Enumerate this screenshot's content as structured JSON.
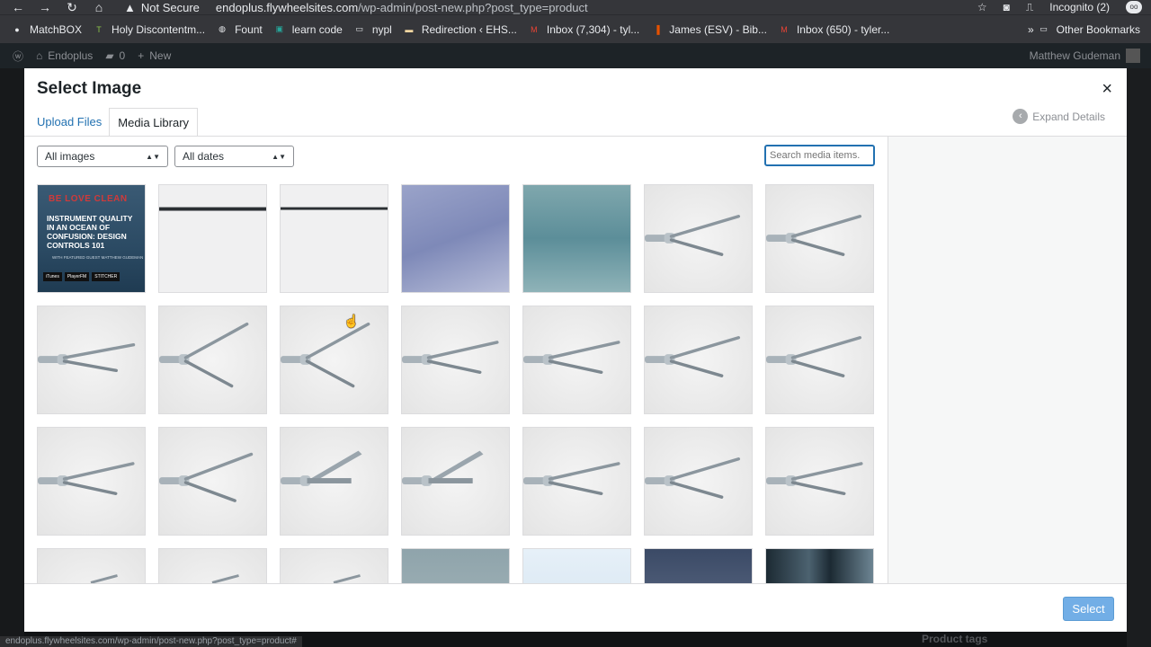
{
  "browser": {
    "security": "Not Secure",
    "url_host": "endoplus.flywheelsites.com",
    "url_path": "/wp-admin/post-new.php?post_type=product",
    "incognito": "Incognito (2)",
    "bookmarks": [
      {
        "label": "MatchBOX",
        "icon": "matchbox-icon",
        "color": "#e8eaed"
      },
      {
        "label": "Holy Discontentm...",
        "icon": "tgc-icon",
        "color": "#8bc34a"
      },
      {
        "label": "Fount",
        "icon": "globe-icon",
        "color": "#e8eaed"
      },
      {
        "label": "learn code",
        "icon": "code-icon",
        "color": "#26a69a"
      },
      {
        "label": "nypl",
        "icon": "folder-icon",
        "color": "#e8eaed"
      },
      {
        "label": "Redirection ‹ EHS...",
        "icon": "redirection-icon",
        "color": "#f5d7a1"
      },
      {
        "label": "Inbox (7,304) - tyl...",
        "icon": "gmail-icon",
        "color": "#ea4335"
      },
      {
        "label": "James (ESV) - Bib...",
        "icon": "bible-icon",
        "color": "#e65100"
      },
      {
        "label": "Inbox (650) - tyler...",
        "icon": "gmail-icon",
        "color": "#ea4335"
      }
    ],
    "more": "»",
    "other_bookmarks": "Other Bookmarks",
    "status_url": "endoplus.flywheelsites.com/wp-admin/post-new.php?post_type=product#"
  },
  "adminbar": {
    "site_name": "Endoplus",
    "comments": "0",
    "new_label": "New",
    "user": "Matthew Gudeman"
  },
  "modal": {
    "title": "Select Image",
    "close": "×",
    "tabs": [
      "Upload Files",
      "Media Library"
    ],
    "expand_details": "Expand Details",
    "filter_type": "All images",
    "filter_date": "All dates",
    "search_placeholder": "Search media items.",
    "select_button": "Select"
  },
  "background": {
    "product_tags": "Product tags"
  },
  "podcast_tile": {
    "logo": "BE LOVE CLEAN",
    "headline": "Instrument Quality in an Ocean of Confusion: Design Controls 101",
    "sub": "WITH FEATURED GUEST MATTHEW GUDEMAN",
    "badges": [
      "iTunes",
      "PlayerFM",
      "STITCHER"
    ]
  },
  "media_items": [
    {
      "kind": "podcast"
    },
    {
      "kind": "line"
    },
    {
      "kind": "line-thin"
    },
    {
      "kind": "photo-purple"
    },
    {
      "kind": "photo-surgery"
    },
    {
      "kind": "grasper",
      "angle": 18
    },
    {
      "kind": "grasper",
      "angle": 18
    },
    {
      "kind": "grasper",
      "angle": 12
    },
    {
      "kind": "grasper",
      "angle": 30
    },
    {
      "kind": "grasper",
      "angle": 30
    },
    {
      "kind": "grasper",
      "angle": 14
    },
    {
      "kind": "grasper",
      "angle": 14
    },
    {
      "kind": "grasper",
      "angle": 18
    },
    {
      "kind": "grasper",
      "angle": 18
    },
    {
      "kind": "grasper",
      "angle": 14
    },
    {
      "kind": "grasper",
      "angle": 22
    },
    {
      "kind": "scissor",
      "angle": 14
    },
    {
      "kind": "scissor",
      "angle": 14
    },
    {
      "kind": "grasper",
      "angle": 14
    },
    {
      "kind": "grasper",
      "angle": 18
    },
    {
      "kind": "grasper",
      "angle": 14
    },
    {
      "kind": "grasper-partial"
    },
    {
      "kind": "grasper-partial"
    },
    {
      "kind": "grasper-partial"
    },
    {
      "kind": "photo-desk"
    },
    {
      "kind": "photo-illustration"
    },
    {
      "kind": "photo-person"
    },
    {
      "kind": "photo-window"
    }
  ]
}
